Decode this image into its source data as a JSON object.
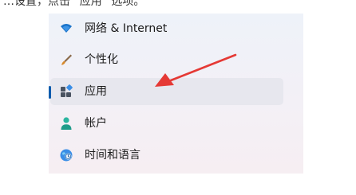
{
  "partial_top_text": "…设置，点击 “应用” 选项。",
  "nav": {
    "items": [
      {
        "label": "网络 & Internet",
        "icon": "wifi-icon"
      },
      {
        "label": "个性化",
        "icon": "paintbrush-icon"
      },
      {
        "label": "应用",
        "icon": "apps-icon",
        "selected": true
      },
      {
        "label": "帐户",
        "icon": "person-icon"
      },
      {
        "label": "时间和语言",
        "icon": "globe-clock-icon"
      }
    ]
  },
  "colors": {
    "accent": "#0b5cad",
    "annotation_arrow": "#e53935"
  }
}
